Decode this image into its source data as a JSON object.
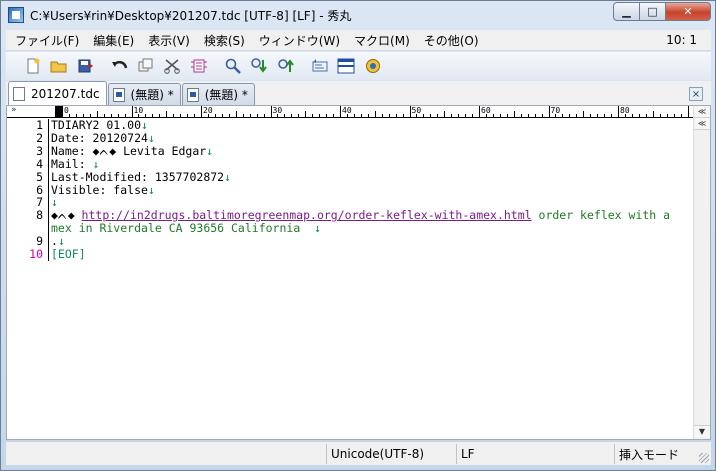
{
  "window": {
    "title": "C:¥Users¥rin¥Desktop¥201207.tdc  [UTF-8] [LF] - 秀丸",
    "min_glyph": "▁",
    "max_glyph": "□",
    "close_glyph": "✕"
  },
  "menu": {
    "items": [
      "ファイル(F)",
      "編集(E)",
      "表示(V)",
      "検索(S)",
      "ウィンドウ(W)",
      "マクロ(M)",
      "その他(O)"
    ],
    "cursor_position": "10: 1"
  },
  "toolbar": {
    "buttons": [
      "new-file-icon",
      "open-folder-icon",
      "save-icon",
      "undo-icon",
      "copy-icon",
      "cut-icon",
      "paste-icon",
      "find-icon",
      "find-down-icon",
      "find-up-icon",
      "grep-icon",
      "split-window-icon",
      "help-icon"
    ]
  },
  "tabs": {
    "items": [
      {
        "label": "201207.tdc"
      },
      {
        "label": "(無題) *"
      },
      {
        "label": "(無題) *"
      }
    ],
    "close_glyph": "×"
  },
  "ruler": {
    "arrow": "»",
    "marks": [
      "0",
      "10",
      "20",
      "30",
      "40",
      "50",
      "60",
      "70",
      "80"
    ],
    "scroll_up": "≪",
    "scroll_left": "≪"
  },
  "editor": {
    "lines": [
      {
        "num": "1",
        "text": "TDIARY2 01.00",
        "eol": "↓"
      },
      {
        "num": "2",
        "text": "Date: 20120724",
        "eol": "↓"
      },
      {
        "num": "3",
        "text": "Name: ◆ᨈ◆ Levita Edgar",
        "eol": "↓"
      },
      {
        "num": "4",
        "text": "Mail: ",
        "eol": "↓"
      },
      {
        "num": "5",
        "text": "Last-Modified: 1357702872",
        "eol": "↓"
      },
      {
        "num": "6",
        "text": "Visible: false",
        "eol": "↓"
      },
      {
        "num": "7",
        "text": "",
        "eol": "↓"
      },
      {
        "num": "8",
        "prefix": "◆ᨈ◆ ",
        "url": "http://in2drugs.baltimoregreenmap.org/order-keflex-with-amex.html",
        "tail": " order keflex with a"
      },
      {
        "num": "",
        "tail": "mex in Riverdale CA 93656 California  ",
        "eol": "↓"
      },
      {
        "num": "9",
        "text": ".",
        "eol": "↓"
      },
      {
        "num": "10",
        "eof": "[EOF]"
      }
    ]
  },
  "status": {
    "encoding": "Unicode(UTF-8)",
    "line_ending": "LF",
    "mode": "挿入モード"
  }
}
